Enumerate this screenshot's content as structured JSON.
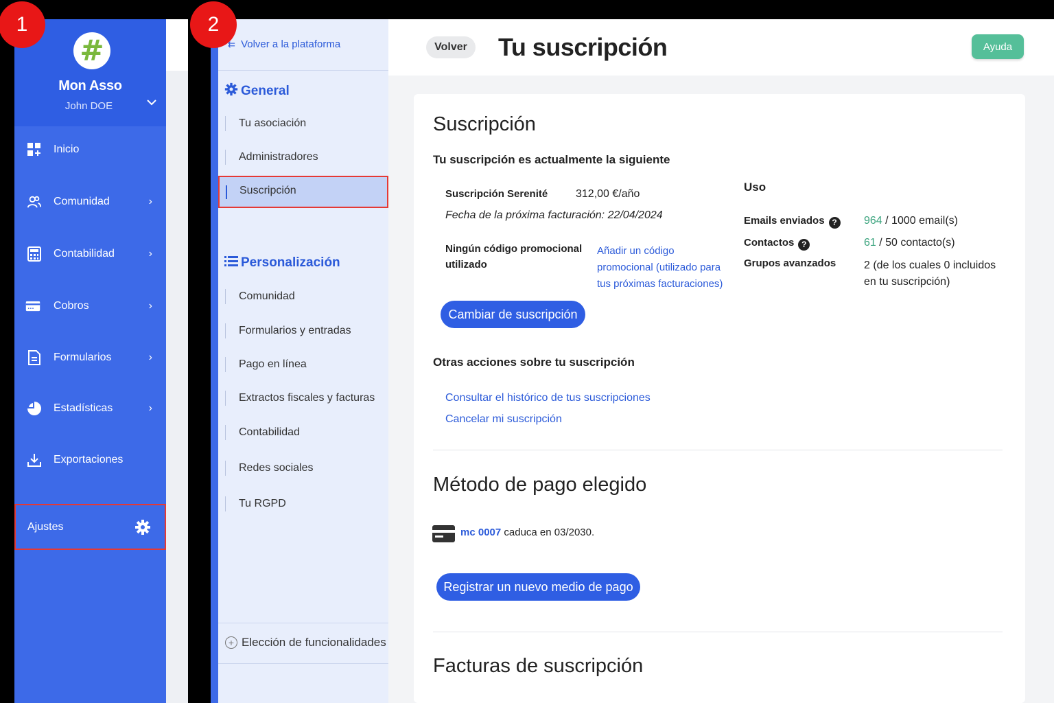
{
  "sidebar": {
    "org_name": "Mon Asso",
    "user_name": "John DOE",
    "logo_glyph": "#",
    "items": [
      {
        "label": "Inicio",
        "icon": "dashboard-icon"
      },
      {
        "label": "Comunidad",
        "icon": "users-icon"
      },
      {
        "label": "Contabilidad",
        "icon": "calculator-icon"
      },
      {
        "label": "Cobros",
        "icon": "credit-card-icon"
      },
      {
        "label": "Formularios",
        "icon": "document-icon"
      },
      {
        "label": "Estadísticas",
        "icon": "pie-chart-icon"
      },
      {
        "label": "Exportaciones",
        "icon": "download-icon"
      }
    ],
    "settings_label": "Ajustes"
  },
  "subnav": {
    "back_label": "Volver a la plataforma",
    "general_title": "General",
    "general_items": [
      "Tu asociación",
      "Administradores"
    ],
    "active_item": "Suscripción",
    "personalization_title": "Personalización",
    "personalization_items": [
      "Comunidad",
      "Formularios y entradas",
      "Pago en línea",
      "Extractos fiscales y facturas",
      "Contabilidad",
      "Redes sociales",
      "Tu RGPD"
    ],
    "features_label": "Elección de funcionalidades"
  },
  "topbar": {
    "back_button": "Volver",
    "title": "Tu suscripción",
    "help_button": "Ayuda"
  },
  "subscription": {
    "heading": "Suscripción",
    "subheading": "Tu suscripción es actualmente la siguiente",
    "plan_name": "Suscripción Serenité",
    "plan_price": "312,00 €/año",
    "next_billing": "Fecha de la próxima facturación: 22/04/2024",
    "promo_status_line1": "Ningún código promocional",
    "promo_status_line2": "utilizado",
    "promo_link_line1": "Añadir un código",
    "promo_link_line2": "promocional (utilizado para",
    "promo_link_line3": "tus próximas facturaciones)",
    "change_button": "Cambiar de suscripción",
    "usage": {
      "title": "Uso",
      "emails_label": "Emails enviados",
      "emails_used": "964",
      "emails_limit": " / 1000 email(s)",
      "contacts_label": "Contactos",
      "contacts_used": "61",
      "contacts_limit": " / 50 contacto(s)",
      "groups_label": "Grupos avanzados",
      "groups_value_line1": "2 (de los cuales 0 incluidos",
      "groups_value_line2": "en tu suscripción)"
    },
    "other_actions_title": "Otras acciones sobre tu suscripción",
    "history_link": "Consultar el histórico de tus suscripciones",
    "cancel_link": "Cancelar mi suscripción"
  },
  "payment": {
    "heading": "Método de pago elegido",
    "card_brand_number": "mc 0007",
    "expiry_text": " caduca en 03/2030.",
    "register_button": "Registrar un nuevo medio de pago"
  },
  "invoices": {
    "heading": "Facturas de suscripción"
  },
  "badges": {
    "one": "1",
    "two": "2"
  },
  "colors": {
    "sidebar_blue": "#3d6ae8",
    "link_blue": "#2b5ad9",
    "help_green": "#55bf99",
    "usage_green": "#3aa37d",
    "highlight_red": "#e53935"
  }
}
